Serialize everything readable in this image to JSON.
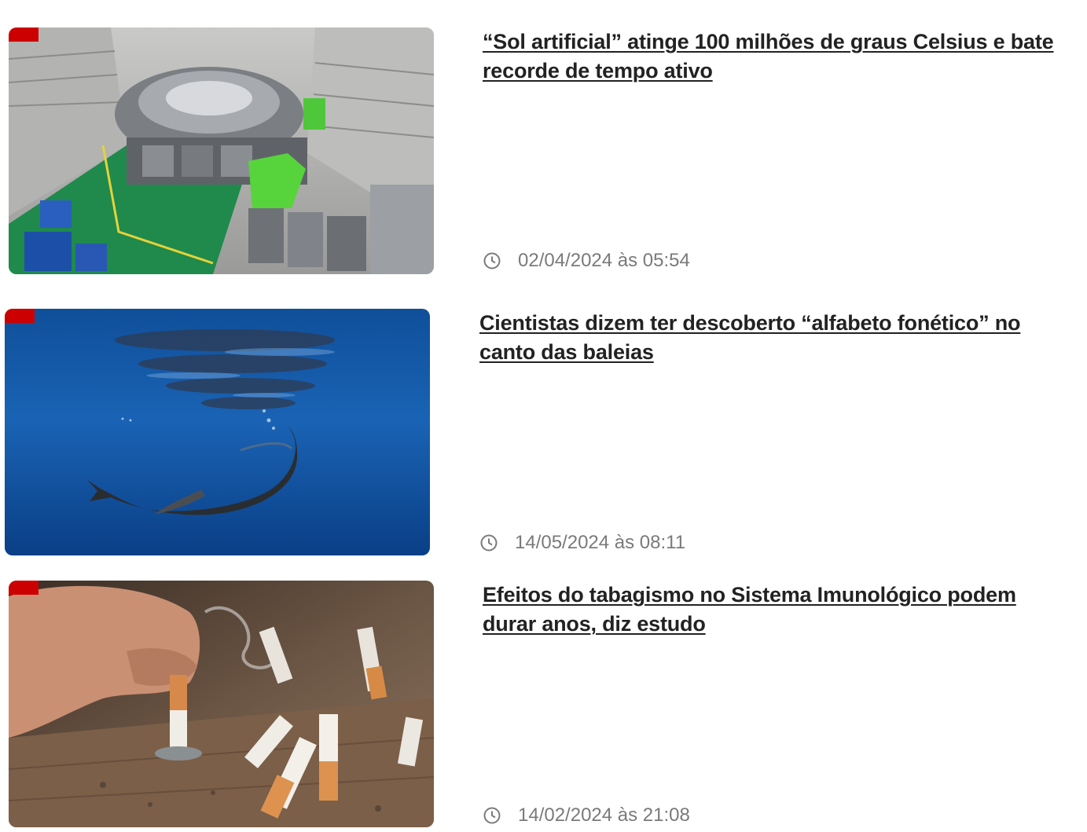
{
  "articles": [
    {
      "title": "“Sol artificial” atinge 100 milhões de graus Celsius e bate recorde de tempo ativo",
      "date": "02/04/2024 às 05:54",
      "image": "fusion-reactor-hall"
    },
    {
      "title": "Cientistas dizem ter descoberto “alfabeto fonético” no canto das baleias",
      "date": "14/05/2024 às 08:11",
      "image": "sperm-whale-underwater"
    },
    {
      "title": "Efeitos do tabagismo no Sistema Imunológico podem durar anos, diz estudo",
      "date": "14/02/2024 às 21:08",
      "image": "cigarette-butts"
    }
  ],
  "colors": {
    "tag": "#cc0000",
    "headline": "#222222",
    "meta": "#7a7a7a"
  },
  "icons": {
    "timestamp": "clock-icon"
  }
}
